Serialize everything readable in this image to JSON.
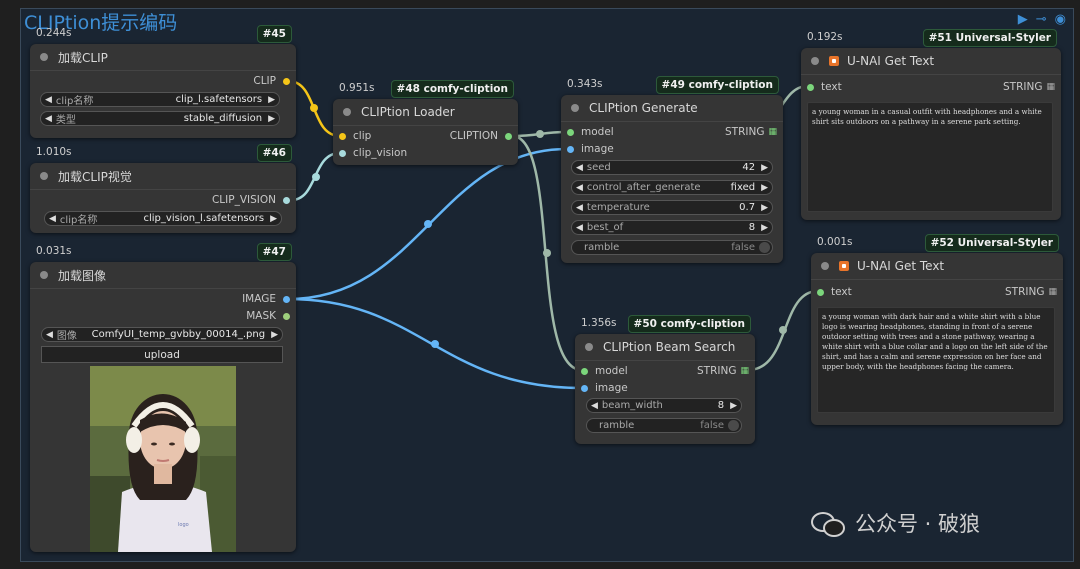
{
  "group": {
    "title": "CLIPtion提示编码"
  },
  "colors": {
    "accent": "#3e8fd6",
    "wire_clip": "#f5c518",
    "wire_clip_vision": "#a8dadc",
    "wire_image": "#64b5f6",
    "wire_model": "#9fb8a8",
    "wire_string": "#9fb8a8"
  },
  "nodes": {
    "n45": {
      "time": "0.244s",
      "badge": "#45",
      "title": "加载CLIP",
      "out_clip": "CLIP",
      "w1": {
        "name": "clip名称",
        "value": "clip_l.safetensors"
      },
      "w2": {
        "name": "类型",
        "value": "stable_diffusion"
      }
    },
    "n46": {
      "time": "1.010s",
      "badge": "#46",
      "title": "加载CLIP视觉",
      "out_clip_vision": "CLIP_VISION",
      "w1": {
        "name": "clip名称",
        "value": "clip_vision_l.safetensors"
      }
    },
    "n47": {
      "time": "0.031s",
      "badge": "#47",
      "title": "加载图像",
      "out_image": "IMAGE",
      "out_mask": "MASK",
      "w1": {
        "name": "图像",
        "value": "ComfyUI_temp_gvbby_00014_.png"
      },
      "upload": "upload"
    },
    "n48": {
      "time": "0.951s",
      "badge": "#48 comfy-cliption",
      "title": "CLIPtion Loader",
      "in_clip": "clip",
      "in_clip_vision": "clip_vision",
      "out_cliption": "CLIPTION"
    },
    "n49": {
      "time": "0.343s",
      "badge": "#49 comfy-cliption",
      "title": "CLIPtion Generate",
      "in_model": "model",
      "in_image": "image",
      "out_string": "STRING",
      "w_seed": {
        "name": "seed",
        "value": "42"
      },
      "w_cag": {
        "name": "control_after_generate",
        "value": "fixed"
      },
      "w_temp": {
        "name": "temperature",
        "value": "0.7"
      },
      "w_bestof": {
        "name": "best_of",
        "value": "8"
      },
      "t_ramble": {
        "name": "ramble",
        "value": "false"
      }
    },
    "n50": {
      "time": "1.356s",
      "badge": "#50 comfy-cliption",
      "title": "CLIPtion Beam Search",
      "in_model": "model",
      "in_image": "image",
      "out_string": "STRING",
      "w_beam": {
        "name": "beam_width",
        "value": "8"
      },
      "t_ramble": {
        "name": "ramble",
        "value": "false"
      }
    },
    "n51": {
      "time": "0.192s",
      "badge": "#51 Universal-Styler",
      "title": "U-NAI Get Text",
      "in_text": "text",
      "out_string": "STRING",
      "text": "a young woman in a casual outfit with headphones and a white shirt sits outdoors on a pathway in a serene park setting."
    },
    "n52": {
      "time": "0.001s",
      "badge": "#52 Universal-Styler",
      "title": "U-NAI Get Text",
      "in_text": "text",
      "out_string": "STRING",
      "text": "a young woman with dark hair and a white shirt with a blue logo is wearing headphones, standing in front of a serene outdoor setting with trees and a stone pathway, wearing a white shirt with a blue collar and a logo on the left side of the shirt, and has a calm and serene expression on her face and upper body, with the headphones facing the camera."
    }
  },
  "watermark": {
    "text": "公众号 · 破狼"
  }
}
